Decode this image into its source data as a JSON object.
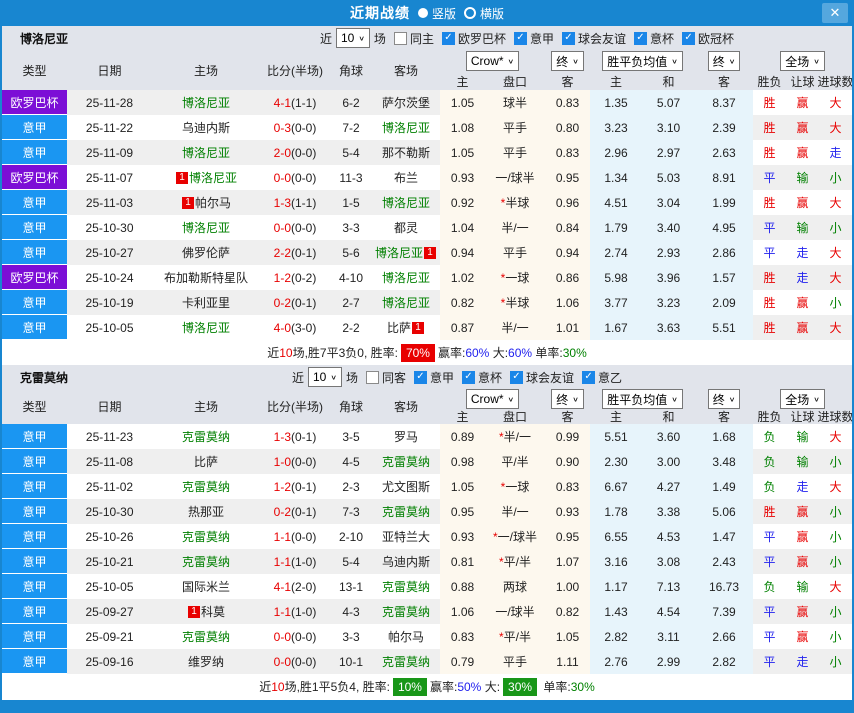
{
  "titlebar": {
    "title": "近期战绩",
    "vertical": "竖版",
    "horizontal": "横版"
  },
  "icons": {
    "close": "✕",
    "check": "✓",
    "chevron": "∨"
  },
  "red_card_label": "1",
  "sections": [
    {
      "team": "博洛尼亚",
      "filters": {
        "near": "近",
        "count": "10",
        "games": "场",
        "same": "同主",
        "leagues": [
          "欧罗巴杯",
          "意甲",
          "球会友谊",
          "意杯",
          "欧冠杯"
        ]
      },
      "controls": {
        "book": "Crow*",
        "final_a": "终",
        "avg": "胜平负均值",
        "final_b": "终",
        "scope": "全场"
      },
      "headers": {
        "cols": [
          "类型",
          "日期",
          "主场",
          "比分(半场)",
          "角球",
          "客场"
        ],
        "sub": [
          "主",
          "盘口",
          "客",
          "主",
          "和",
          "客",
          "胜负",
          "让球",
          "进球数"
        ]
      },
      "rows": [
        {
          "league": "欧罗巴杯",
          "lc": "p",
          "date": "25-11-28",
          "home": "博洛尼亚",
          "hg": 1,
          "hb": "",
          "ft": "4-1",
          "ht": "(1-1)",
          "corner": "6-2",
          "away": "萨尔茨堡",
          "ag": 0,
          "ab": "",
          "oh": "1.05",
          "star": 0,
          "hc": "球半",
          "oa": "0.83",
          "ah": "1.35",
          "ad": "5.07",
          "aa": "8.37",
          "r1": "胜",
          "r2": "赢",
          "r3": "大"
        },
        {
          "league": "意甲",
          "lc": "b",
          "date": "25-11-22",
          "home": "乌迪内斯",
          "hg": 0,
          "hb": "",
          "ft": "0-3",
          "ht": "(0-0)",
          "corner": "7-2",
          "away": "博洛尼亚",
          "ag": 1,
          "ab": "",
          "oh": "1.08",
          "star": 0,
          "hc": "平手",
          "oa": "0.80",
          "ah": "3.23",
          "ad": "3.10",
          "aa": "2.39",
          "r1": "胜",
          "r2": "赢",
          "r3": "大"
        },
        {
          "league": "意甲",
          "lc": "b",
          "date": "25-11-09",
          "home": "博洛尼亚",
          "hg": 1,
          "hb": "",
          "ft": "2-0",
          "ht": "(0-0)",
          "corner": "5-4",
          "away": "那不勒斯",
          "ag": 0,
          "ab": "",
          "oh": "1.05",
          "star": 0,
          "hc": "平手",
          "oa": "0.83",
          "ah": "2.96",
          "ad": "2.97",
          "aa": "2.63",
          "r1": "胜",
          "r2": "赢",
          "r3": "走"
        },
        {
          "league": "欧罗巴杯",
          "lc": "p",
          "date": "25-11-07",
          "home": "博洛尼亚",
          "hg": 1,
          "hb": "pre",
          "ft": "0-0",
          "ht": "(0-0)",
          "corner": "11-3",
          "away": "布兰",
          "ag": 0,
          "ab": "",
          "oh": "0.93",
          "star": 0,
          "hc": "一/球半",
          "oa": "0.95",
          "ah": "1.34",
          "ad": "5.03",
          "aa": "8.91",
          "r1": "平",
          "r2": "输",
          "r3": "小"
        },
        {
          "league": "意甲",
          "lc": "b",
          "date": "25-11-03",
          "home": "帕尔马",
          "hg": 0,
          "hb": "pre",
          "ft": "1-3",
          "ht": "(1-1)",
          "corner": "1-5",
          "away": "博洛尼亚",
          "ag": 1,
          "ab": "",
          "oh": "0.92",
          "star": 1,
          "hc": "半球",
          "oa": "0.96",
          "ah": "4.51",
          "ad": "3.04",
          "aa": "1.99",
          "r1": "胜",
          "r2": "赢",
          "r3": "大"
        },
        {
          "league": "意甲",
          "lc": "b",
          "date": "25-10-30",
          "home": "博洛尼亚",
          "hg": 1,
          "hb": "",
          "ft": "0-0",
          "ht": "(0-0)",
          "corner": "3-3",
          "away": "都灵",
          "ag": 0,
          "ab": "",
          "oh": "1.04",
          "star": 0,
          "hc": "半/一",
          "oa": "0.84",
          "ah": "1.79",
          "ad": "3.40",
          "aa": "4.95",
          "r1": "平",
          "r2": "输",
          "r3": "小"
        },
        {
          "league": "意甲",
          "lc": "b",
          "date": "25-10-27",
          "home": "佛罗伦萨",
          "hg": 0,
          "hb": "",
          "ft": "2-2",
          "ht": "(0-1)",
          "corner": "5-6",
          "away": "博洛尼亚",
          "ag": 1,
          "ab": "post",
          "oh": "0.94",
          "star": 0,
          "hc": "平手",
          "oa": "0.94",
          "ah": "2.74",
          "ad": "2.93",
          "aa": "2.86",
          "r1": "平",
          "r2": "走",
          "r3": "大"
        },
        {
          "league": "欧罗巴杯",
          "lc": "p",
          "date": "25-10-24",
          "home": "布加勒斯特星队",
          "hg": 0,
          "hb": "",
          "ft": "1-2",
          "ht": "(0-2)",
          "corner": "4-10",
          "away": "博洛尼亚",
          "ag": 1,
          "ab": "",
          "oh": "1.02",
          "star": 1,
          "hc": "一球",
          "oa": "0.86",
          "ah": "5.98",
          "ad": "3.96",
          "aa": "1.57",
          "r1": "胜",
          "r2": "走",
          "r3": "大"
        },
        {
          "league": "意甲",
          "lc": "b",
          "date": "25-10-19",
          "home": "卡利亚里",
          "hg": 0,
          "hb": "",
          "ft": "0-2",
          "ht": "(0-1)",
          "corner": "2-7",
          "away": "博洛尼亚",
          "ag": 1,
          "ab": "",
          "oh": "0.82",
          "star": 1,
          "hc": "半球",
          "oa": "1.06",
          "ah": "3.77",
          "ad": "3.23",
          "aa": "2.09",
          "r1": "胜",
          "r2": "赢",
          "r3": "小"
        },
        {
          "league": "意甲",
          "lc": "b",
          "date": "25-10-05",
          "home": "博洛尼亚",
          "hg": 1,
          "hb": "",
          "ft": "4-0",
          "ht": "(3-0)",
          "corner": "2-2",
          "away": "比萨",
          "ag": 0,
          "ab": "post",
          "oh": "0.87",
          "star": 0,
          "hc": "半/一",
          "oa": "1.01",
          "ah": "1.67",
          "ad": "3.63",
          "aa": "5.51",
          "r1": "胜",
          "r2": "赢",
          "r3": "大"
        }
      ],
      "summary": [
        {
          "t": "近"
        },
        {
          "t": "10",
          "c": "red"
        },
        {
          "t": "场,胜7平3负0, 胜率:"
        },
        {
          "t": "70%",
          "bg": "red"
        },
        {
          "t": "赢率:"
        },
        {
          "t": "60%",
          "c": "blue"
        },
        {
          "t": " 大:"
        },
        {
          "t": "60%",
          "c": "blue"
        },
        {
          "t": " 单率:"
        },
        {
          "t": "30%",
          "c": "green"
        }
      ]
    },
    {
      "team": "克雷莫纳",
      "filters": {
        "near": "近",
        "count": "10",
        "games": "场",
        "same": "同客",
        "leagues": [
          "意甲",
          "意杯",
          "球会友谊",
          "意乙"
        ]
      },
      "controls": {
        "book": "Crow*",
        "final_a": "终",
        "avg": "胜平负均值",
        "final_b": "终",
        "scope": "全场"
      },
      "headers": {
        "cols": [
          "类型",
          "日期",
          "主场",
          "比分(半场)",
          "角球",
          "客场"
        ],
        "sub": [
          "主",
          "盘口",
          "客",
          "主",
          "和",
          "客",
          "胜负",
          "让球",
          "进球数"
        ]
      },
      "rows": [
        {
          "league": "意甲",
          "lc": "b",
          "date": "25-11-23",
          "home": "克雷莫纳",
          "hg": 1,
          "hb": "",
          "ft": "1-3",
          "ht": "(0-1)",
          "corner": "3-5",
          "away": "罗马",
          "ag": 0,
          "ab": "",
          "oh": "0.89",
          "star": 1,
          "hc": "半/一",
          "oa": "0.99",
          "ah": "5.51",
          "ad": "3.60",
          "aa": "1.68",
          "r1": "负",
          "r2": "输",
          "r3": "大"
        },
        {
          "league": "意甲",
          "lc": "b",
          "date": "25-11-08",
          "home": "比萨",
          "hg": 0,
          "hb": "",
          "ft": "1-0",
          "ht": "(0-0)",
          "corner": "4-5",
          "away": "克雷莫纳",
          "ag": 1,
          "ab": "",
          "oh": "0.98",
          "star": 0,
          "hc": "平/半",
          "oa": "0.90",
          "ah": "2.30",
          "ad": "3.00",
          "aa": "3.48",
          "r1": "负",
          "r2": "输",
          "r3": "小"
        },
        {
          "league": "意甲",
          "lc": "b",
          "date": "25-11-02",
          "home": "克雷莫纳",
          "hg": 1,
          "hb": "",
          "ft": "1-2",
          "ht": "(0-1)",
          "corner": "2-3",
          "away": "尤文图斯",
          "ag": 0,
          "ab": "",
          "oh": "1.05",
          "star": 1,
          "hc": "一球",
          "oa": "0.83",
          "ah": "6.67",
          "ad": "4.27",
          "aa": "1.49",
          "r1": "负",
          "r2": "走",
          "r3": "大"
        },
        {
          "league": "意甲",
          "lc": "b",
          "date": "25-10-30",
          "home": "热那亚",
          "hg": 0,
          "hb": "",
          "ft": "0-2",
          "ht": "(0-1)",
          "corner": "7-3",
          "away": "克雷莫纳",
          "ag": 1,
          "ab": "",
          "oh": "0.95",
          "star": 0,
          "hc": "半/一",
          "oa": "0.93",
          "ah": "1.78",
          "ad": "3.38",
          "aa": "5.06",
          "r1": "胜",
          "r2": "赢",
          "r3": "小"
        },
        {
          "league": "意甲",
          "lc": "b",
          "date": "25-10-26",
          "home": "克雷莫纳",
          "hg": 1,
          "hb": "",
          "ft": "1-1",
          "ht": "(0-0)",
          "corner": "2-10",
          "away": "亚特兰大",
          "ag": 0,
          "ab": "",
          "oh": "0.93",
          "star": 1,
          "hc": "一/球半",
          "oa": "0.95",
          "ah": "6.55",
          "ad": "4.53",
          "aa": "1.47",
          "r1": "平",
          "r2": "赢",
          "r3": "小"
        },
        {
          "league": "意甲",
          "lc": "b",
          "date": "25-10-21",
          "home": "克雷莫纳",
          "hg": 1,
          "hb": "",
          "ft": "1-1",
          "ht": "(1-0)",
          "corner": "5-4",
          "away": "乌迪内斯",
          "ag": 0,
          "ab": "",
          "oh": "0.81",
          "star": 1,
          "hc": "平/半",
          "oa": "1.07",
          "ah": "3.16",
          "ad": "3.08",
          "aa": "2.43",
          "r1": "平",
          "r2": "赢",
          "r3": "小"
        },
        {
          "league": "意甲",
          "lc": "b",
          "date": "25-10-05",
          "home": "国际米兰",
          "hg": 0,
          "hb": "",
          "ft": "4-1",
          "ht": "(2-0)",
          "corner": "13-1",
          "away": "克雷莫纳",
          "ag": 1,
          "ab": "",
          "oh": "0.88",
          "star": 0,
          "hc": "两球",
          "oa": "1.00",
          "ah": "1.17",
          "ad": "7.13",
          "aa": "16.73",
          "r1": "负",
          "r2": "输",
          "r3": "大"
        },
        {
          "league": "意甲",
          "lc": "b",
          "date": "25-09-27",
          "home": "科莫",
          "hg": 0,
          "hb": "pre",
          "ft": "1-1",
          "ht": "(1-0)",
          "corner": "4-3",
          "away": "克雷莫纳",
          "ag": 1,
          "ab": "",
          "oh": "1.06",
          "star": 0,
          "hc": "一/球半",
          "oa": "0.82",
          "ah": "1.43",
          "ad": "4.54",
          "aa": "7.39",
          "r1": "平",
          "r2": "赢",
          "r3": "小"
        },
        {
          "league": "意甲",
          "lc": "b",
          "date": "25-09-21",
          "home": "克雷莫纳",
          "hg": 1,
          "hb": "",
          "ft": "0-0",
          "ht": "(0-0)",
          "corner": "3-3",
          "away": "帕尔马",
          "ag": 0,
          "ab": "",
          "oh": "0.83",
          "star": 1,
          "hc": "平/半",
          "oa": "1.05",
          "ah": "2.82",
          "ad": "3.11",
          "aa": "2.66",
          "r1": "平",
          "r2": "赢",
          "r3": "小"
        },
        {
          "league": "意甲",
          "lc": "b",
          "date": "25-09-16",
          "home": "维罗纳",
          "hg": 0,
          "hb": "",
          "ft": "0-0",
          "ht": "(0-0)",
          "corner": "10-1",
          "away": "克雷莫纳",
          "ag": 1,
          "ab": "",
          "oh": "0.79",
          "star": 0,
          "hc": "平手",
          "oa": "1.11",
          "ah": "2.76",
          "ad": "2.99",
          "aa": "2.82",
          "r1": "平",
          "r2": "走",
          "r3": "小"
        }
      ],
      "summary": [
        {
          "t": "近"
        },
        {
          "t": "10",
          "c": "red"
        },
        {
          "t": "场,胜1平5负4, 胜率:"
        },
        {
          "t": "10%",
          "bg": "green"
        },
        {
          "t": "赢率:"
        },
        {
          "t": "50%",
          "c": "blue"
        },
        {
          "t": " 大:"
        },
        {
          "t": "30%",
          "bg": "green"
        },
        {
          "t": " 单率:"
        },
        {
          "t": "30%",
          "c": "green"
        }
      ]
    }
  ]
}
